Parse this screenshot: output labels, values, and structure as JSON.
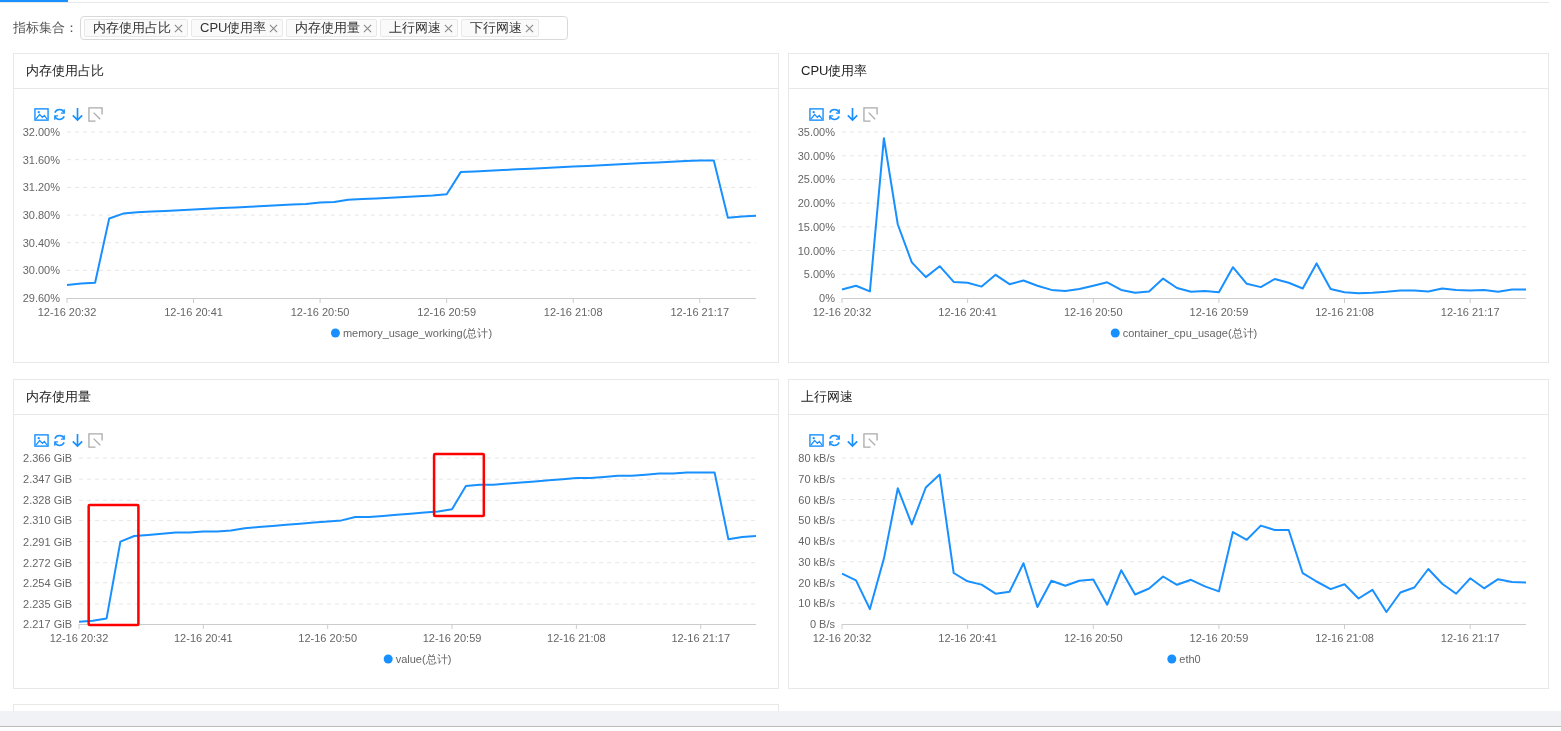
{
  "filter": {
    "label": "指标集合：",
    "tags": [
      "内存使用占比",
      "CPU使用率",
      "内存使用量",
      "上行网速",
      "下行网速"
    ]
  },
  "cards": [
    {
      "title": "内存使用占比",
      "chart_data": {
        "type": "line",
        "categories": [
          "12-16 20:32",
          null,
          null,
          null,
          null,
          null,
          null,
          null,
          null,
          "12-16 20:41",
          null,
          null,
          null,
          null,
          null,
          null,
          null,
          null,
          "12-16 20:50",
          null,
          null,
          null,
          null,
          null,
          null,
          null,
          null,
          "12-16 20:59",
          null,
          null,
          null,
          null,
          null,
          null,
          null,
          null,
          "12-16 21:08",
          null,
          null,
          null,
          null,
          null,
          null,
          null,
          null,
          "12-16 21:17",
          null,
          null,
          null,
          null
        ],
        "ylim": [
          29.6,
          32
        ],
        "grid": true,
        "yticks": [
          {
            "value": 29.6,
            "label": "29.60%"
          },
          {
            "value": 30.0,
            "label": "30.00%"
          },
          {
            "value": 30.4,
            "label": "30.40%"
          },
          {
            "value": 30.8,
            "label": "30.80%"
          },
          {
            "value": 31.2,
            "label": "31.20%"
          },
          {
            "value": 31.6,
            "label": "31.60%"
          },
          {
            "value": 32.0,
            "label": "32.00%"
          }
        ],
        "series": [
          {
            "name": "memory_usage_working(总计)",
            "color": "#1890ff",
            "values": [
              29.79,
              29.81,
              29.82,
              30.75,
              30.82,
              30.84,
              30.85,
              30.86,
              30.87,
              30.88,
              30.89,
              30.9,
              30.91,
              30.92,
              30.93,
              30.94,
              30.95,
              30.96,
              30.98,
              30.99,
              31.02,
              31.03,
              31.04,
              31.05,
              31.06,
              31.07,
              31.08,
              31.1,
              31.42,
              31.43,
              31.44,
              31.45,
              31.46,
              31.47,
              31.48,
              31.49,
              31.5,
              31.51,
              31.52,
              31.53,
              31.54,
              31.55,
              31.56,
              31.57,
              31.58,
              31.59,
              31.59,
              30.76,
              30.78,
              30.79
            ]
          }
        ]
      }
    },
    {
      "title": "CPU使用率",
      "chart_data": {
        "type": "line",
        "categories": [
          "12-16 20:32",
          null,
          null,
          null,
          null,
          null,
          null,
          null,
          null,
          "12-16 20:41",
          null,
          null,
          null,
          null,
          null,
          null,
          null,
          null,
          "12-16 20:50",
          null,
          null,
          null,
          null,
          null,
          null,
          null,
          null,
          "12-16 20:59",
          null,
          null,
          null,
          null,
          null,
          null,
          null,
          null,
          "12-16 21:08",
          null,
          null,
          null,
          null,
          null,
          null,
          null,
          null,
          "12-16 21:17",
          null,
          null,
          null,
          null
        ],
        "ylim": [
          0,
          35
        ],
        "grid": true,
        "yticks": [
          {
            "value": 0,
            "label": "0%"
          },
          {
            "value": 5,
            "label": "5.00%"
          },
          {
            "value": 10,
            "label": "10.00%"
          },
          {
            "value": 15,
            "label": "15.00%"
          },
          {
            "value": 20,
            "label": "20.00%"
          },
          {
            "value": 25,
            "label": "25.00%"
          },
          {
            "value": 30,
            "label": "30.00%"
          },
          {
            "value": 35,
            "label": "35.00%"
          }
        ],
        "series": [
          {
            "name": "container_cpu_usage(总计)",
            "color": "#1890ff",
            "values": [
              1.8,
              2.6,
              1.4,
              33.7,
              15.5,
              7.5,
              4.4,
              6.7,
              3.4,
              3.2,
              2.4,
              4.9,
              2.9,
              3.7,
              2.6,
              1.7,
              1.5,
              1.9,
              2.6,
              3.3,
              1.7,
              1.1,
              1.4,
              4.1,
              2.1,
              1.3,
              1.5,
              1.2,
              6.5,
              3.0,
              2.3,
              4.0,
              3.2,
              2.0,
              7.3,
              1.9,
              1.2,
              1.0,
              1.1,
              1.3,
              1.6,
              1.6,
              1.4,
              2.0,
              1.7,
              1.6,
              1.7,
              1.3,
              1.8,
              1.8
            ]
          }
        ]
      }
    },
    {
      "title": "内存使用量",
      "chart_data": {
        "type": "line",
        "categories": [
          "12-16 20:32",
          null,
          null,
          null,
          null,
          null,
          null,
          null,
          null,
          "12-16 20:41",
          null,
          null,
          null,
          null,
          null,
          null,
          null,
          null,
          "12-16 20:50",
          null,
          null,
          null,
          null,
          null,
          null,
          null,
          null,
          "12-16 20:59",
          null,
          null,
          null,
          null,
          null,
          null,
          null,
          null,
          "12-16 21:08",
          null,
          null,
          null,
          null,
          null,
          null,
          null,
          null,
          "12-16 21:17",
          null,
          null,
          null,
          null
        ],
        "ylim": [
          2.217,
          2.366
        ],
        "grid": true,
        "yticks": [
          {
            "value": 2.217,
            "label": "2.217 GiB"
          },
          {
            "value": 2.235,
            "label": "2.235 GiB"
          },
          {
            "value": 2.254,
            "label": "2.254 GiB"
          },
          {
            "value": 2.272,
            "label": "2.272 GiB"
          },
          {
            "value": 2.291,
            "label": "2.291 GiB"
          },
          {
            "value": 2.31,
            "label": "2.310 GiB"
          },
          {
            "value": 2.328,
            "label": "2.328 GiB"
          },
          {
            "value": 2.347,
            "label": "2.347 GiB"
          },
          {
            "value": 2.366,
            "label": "2.366 GiB"
          }
        ],
        "series": [
          {
            "name": "value(总计)",
            "color": "#1890ff",
            "values": [
              2.219,
              2.22,
              2.222,
              2.291,
              2.296,
              2.297,
              2.298,
              2.299,
              2.299,
              2.3,
              2.3,
              2.301,
              2.303,
              2.304,
              2.305,
              2.306,
              2.307,
              2.308,
              2.309,
              2.31,
              2.313,
              2.313,
              2.314,
              2.315,
              2.316,
              2.317,
              2.318,
              2.32,
              2.341,
              2.342,
              2.342,
              2.343,
              2.344,
              2.345,
              2.346,
              2.347,
              2.348,
              2.348,
              2.349,
              2.35,
              2.35,
              2.351,
              2.352,
              2.352,
              2.353,
              2.353,
              2.353,
              2.293,
              2.295,
              2.296
            ]
          }
        ]
      },
      "jumps_highlighted": true
    },
    {
      "title": "上行网速",
      "chart_data": {
        "type": "line",
        "categories": [
          "12-16 20:32",
          null,
          null,
          null,
          null,
          null,
          null,
          null,
          null,
          "12-16 20:41",
          null,
          null,
          null,
          null,
          null,
          null,
          null,
          null,
          "12-16 20:50",
          null,
          null,
          null,
          null,
          null,
          null,
          null,
          null,
          "12-16 20:59",
          null,
          null,
          null,
          null,
          null,
          null,
          null,
          null,
          "12-16 21:08",
          null,
          null,
          null,
          null,
          null,
          null,
          null,
          null,
          "12-16 21:17",
          null,
          null,
          null,
          null
        ],
        "ylim": [
          0,
          80
        ],
        "grid": true,
        "yticks": [
          {
            "value": 0,
            "label": "0 B/s"
          },
          {
            "value": 10,
            "label": "10 kB/s"
          },
          {
            "value": 20,
            "label": "20 kB/s"
          },
          {
            "value": 30,
            "label": "30 kB/s"
          },
          {
            "value": 40,
            "label": "40 kB/s"
          },
          {
            "value": 50,
            "label": "50 kB/s"
          },
          {
            "value": 60,
            "label": "60 kB/s"
          },
          {
            "value": 70,
            "label": "70 kB/s"
          },
          {
            "value": 80,
            "label": "80 kB/s"
          }
        ],
        "series": [
          {
            "name": "eth0",
            "color": "#1890ff",
            "values": [
              24.3,
              21,
              7.2,
              31.5,
              65.4,
              48,
              65.8,
              72,
              24.6,
              20.6,
              19,
              14.6,
              15.5,
              29.3,
              8.2,
              20.8,
              18.4,
              20.8,
              21.4,
              9.3,
              25.9,
              14.2,
              17.1,
              22.9,
              18.9,
              21.3,
              18.1,
              15.7,
              44.3,
              40.6,
              47.4,
              45.3,
              45.3,
              24.5,
              20.5,
              16.8,
              19.2,
              12.3,
              16.5,
              5.8,
              15.2,
              17.6,
              26.5,
              19.4,
              14.6,
              22.0,
              17.2,
              21.6,
              20.3,
              20.0
            ]
          }
        ]
      }
    }
  ]
}
